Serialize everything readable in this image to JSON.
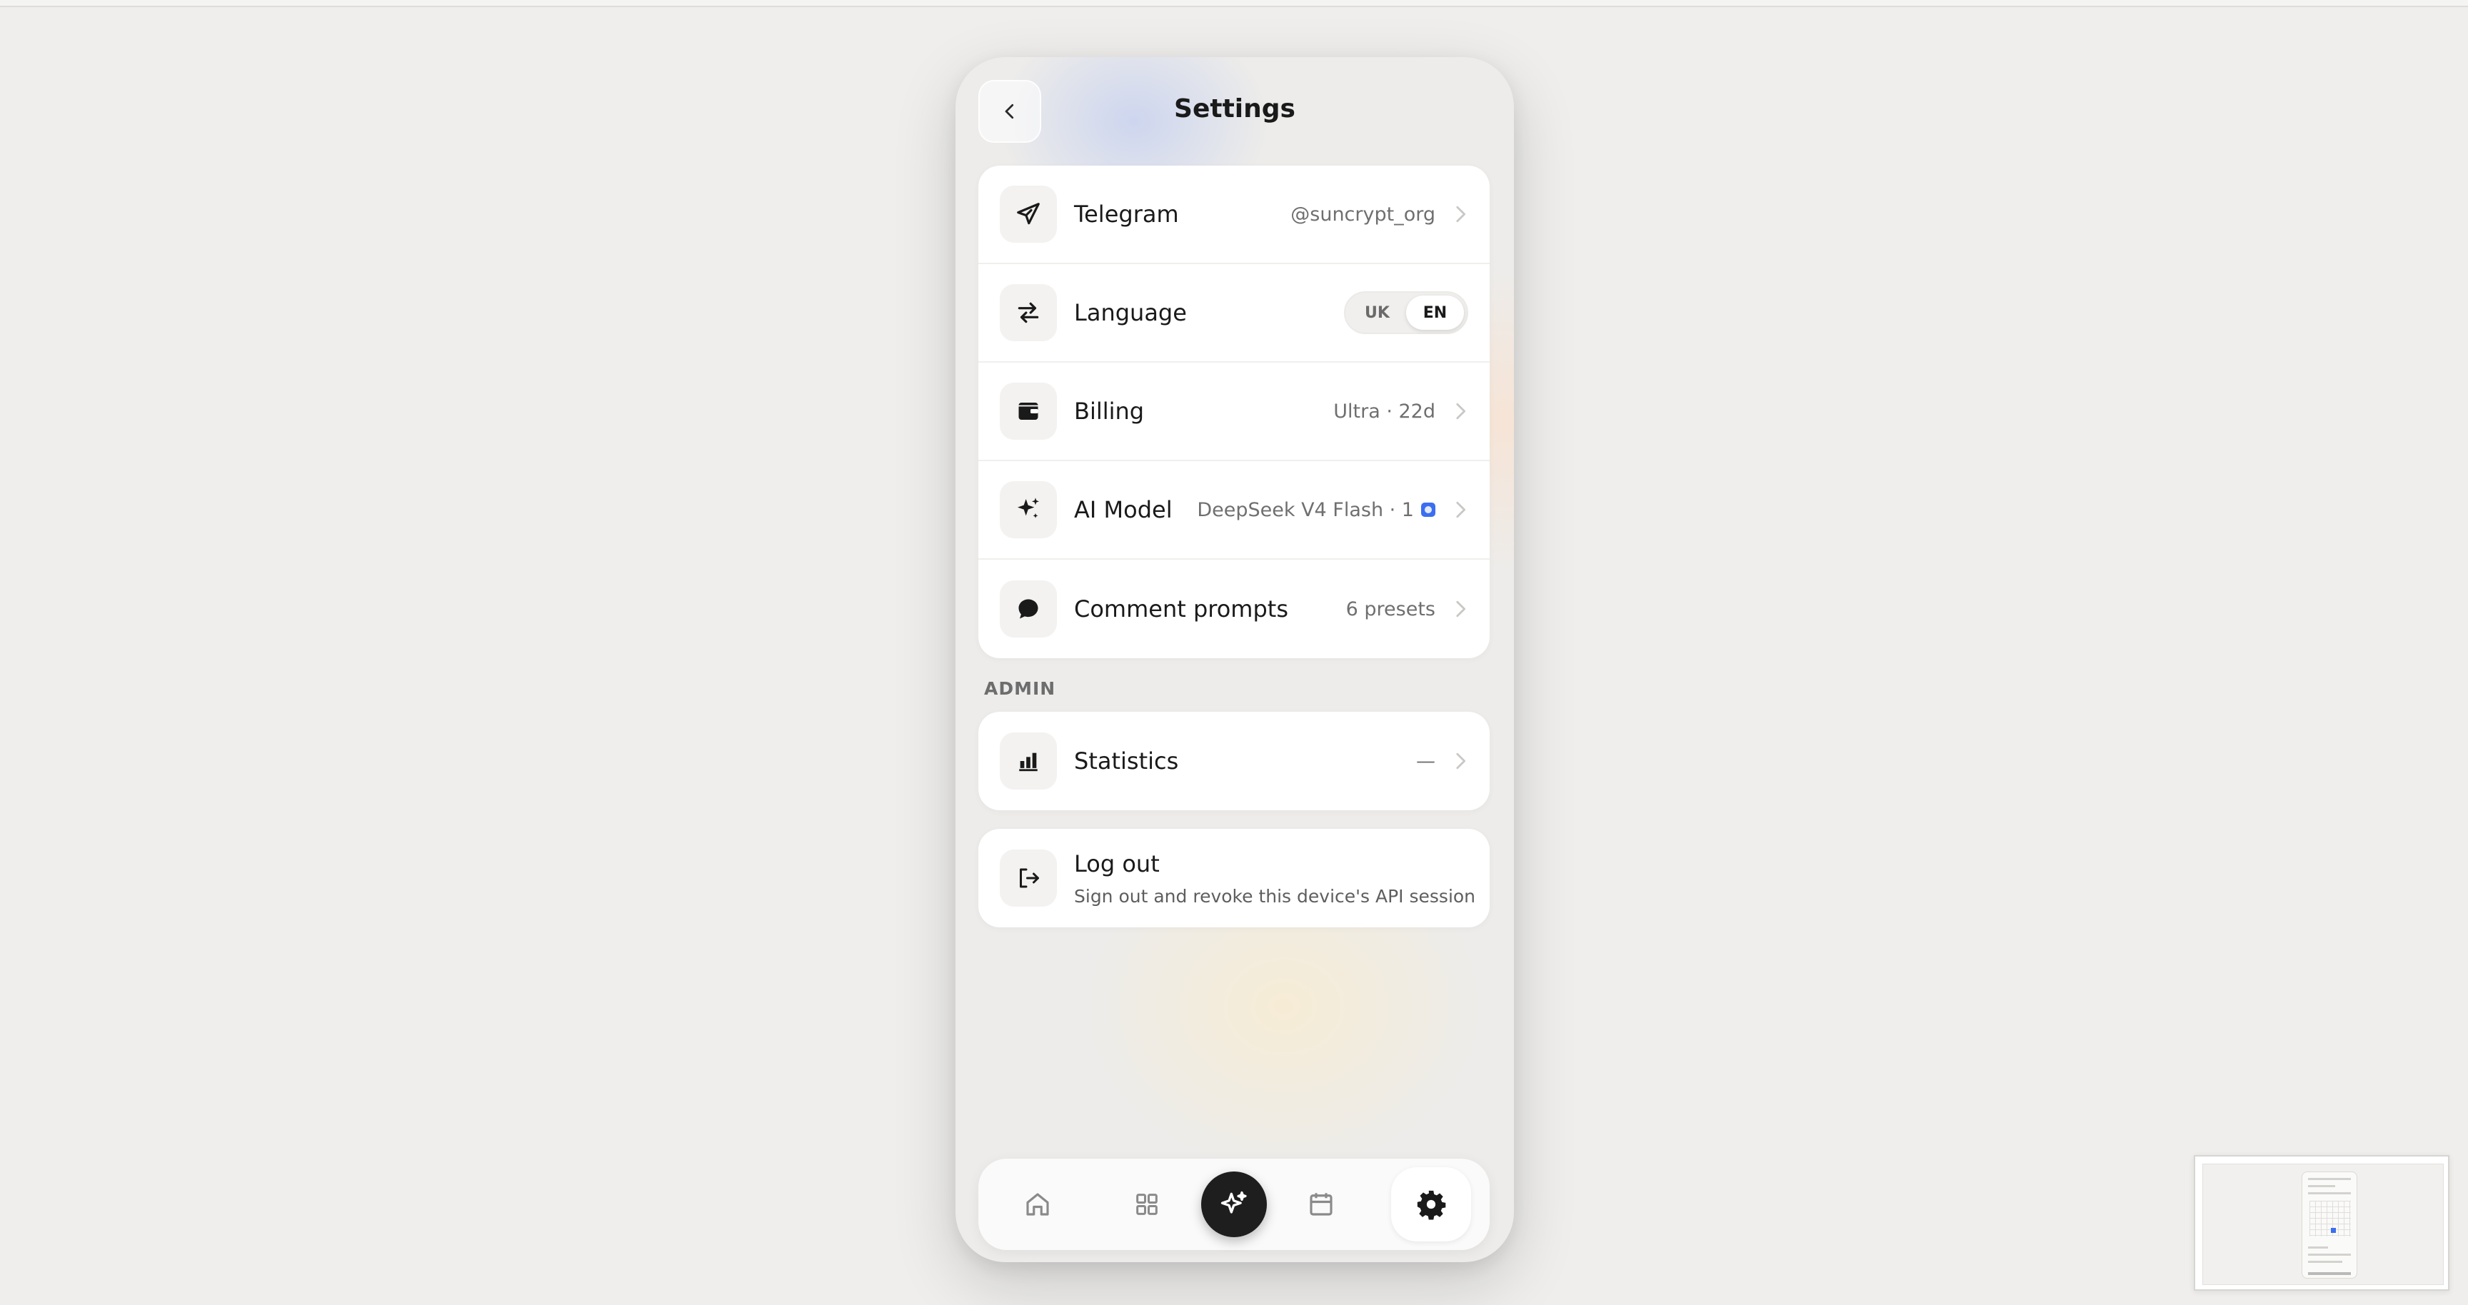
{
  "header": {
    "title": "Settings"
  },
  "settings": {
    "telegram": {
      "label": "Telegram",
      "value": "@suncrypt_org"
    },
    "language": {
      "label": "Language",
      "options": [
        "UK",
        "EN"
      ],
      "selected": "EN"
    },
    "billing": {
      "label": "Billing",
      "value": "Ultra · 22d"
    },
    "ai_model": {
      "label": "AI Model",
      "value": "DeepSeek V4 Flash · 1"
    },
    "comment_prompts": {
      "label": "Comment prompts",
      "value": "6 presets"
    }
  },
  "admin": {
    "section_label": "ADMIN",
    "statistics": {
      "label": "Statistics",
      "value": "—"
    }
  },
  "logout": {
    "title": "Log out",
    "subtitle": "Sign out and revoke this device's API session"
  },
  "tabbar": {
    "items": [
      {
        "icon": "home-icon"
      },
      {
        "icon": "grid-icon"
      },
      {
        "icon": "sparkle-icon"
      },
      {
        "icon": "calendar-icon"
      },
      {
        "icon": "gear-icon",
        "active": true
      }
    ]
  },
  "colors": {
    "accent": "#3b6ef0",
    "card": "#ffffff",
    "background": "#efeeec"
  }
}
